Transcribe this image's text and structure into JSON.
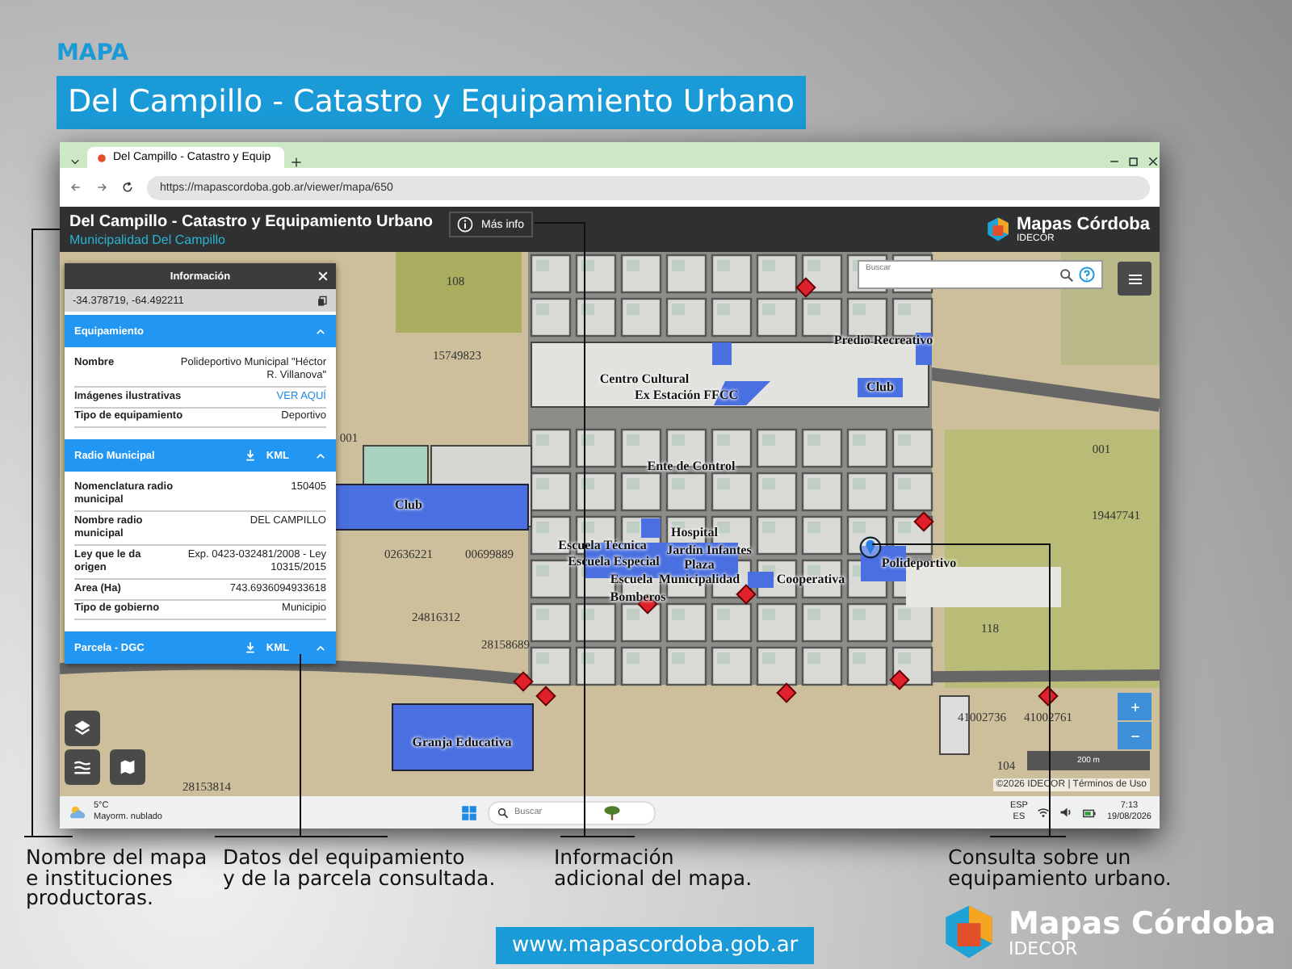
{
  "heading": "MAPA",
  "banner": "Del Campillo - Catastro y Equipamiento Urbano",
  "browser": {
    "tab": "Del Campillo - Catastro y Equip",
    "url": "https://mapascordoba.gob.ar/viewer/mapa/650"
  },
  "app_header": {
    "title": "Del Campillo - Catastro y Equipamiento Urbano",
    "subtitle": "Municipalidad Del Campillo",
    "info_button": "Más info",
    "logo_name": "Mapas Córdoba",
    "logo_sub": "IDECOR"
  },
  "info_panel": {
    "title": "Información",
    "coords": "-34.378719, -64.492211",
    "sections": [
      {
        "title": "Equipamiento",
        "expanded": true,
        "rows": [
          {
            "label": "Nombre",
            "value": "Polideportivo Municipal \"Héctor R. Villanova\"",
            "kind": "text"
          },
          {
            "label": "Imágenes ilustrativas",
            "value": "VER AQUÍ",
            "kind": "link"
          },
          {
            "label": "Tipo de equipamiento",
            "value": "Deportivo",
            "kind": "text"
          }
        ]
      },
      {
        "title": "Radio Municipal",
        "download": "KML",
        "expanded": true,
        "rows": [
          {
            "label": "Nomenclatura radio municipal",
            "value": "150405",
            "kind": "text"
          },
          {
            "label": "Nombre radio municipal",
            "value": "DEL CAMPILLO",
            "kind": "text"
          },
          {
            "label": "Ley que le da origen",
            "value": "Exp. 0423-032481/2008 - Ley 10315/2015",
            "kind": "text"
          },
          {
            "label": "Area (Ha)",
            "value": "743.6936094933618",
            "kind": "text"
          },
          {
            "label": "Tipo de gobierno",
            "value": "Municipio",
            "kind": "text"
          }
        ]
      },
      {
        "title": "Parcela - DGC",
        "download": "KML",
        "expanded": true
      }
    ]
  },
  "map": {
    "search_placeholder": "Buscar",
    "scale": "200 m",
    "attribution": "©2026 IDECOR | Términos de Uso",
    "labels": [
      {
        "text": "108",
        "kind": "parcel"
      },
      {
        "text": "15749823",
        "kind": "parcel"
      },
      {
        "text": "Predio Recreativo",
        "kind": "place"
      },
      {
        "text": "Centro Cultural",
        "kind": "place"
      },
      {
        "text": "Ex Estación FFCC",
        "kind": "place"
      },
      {
        "text": "Club",
        "kind": "place"
      },
      {
        "text": "001",
        "kind": "parcel"
      },
      {
        "text": "Ente de Control",
        "kind": "place"
      },
      {
        "text": "001",
        "kind": "parcel"
      },
      {
        "text": "Club",
        "kind": "place"
      },
      {
        "text": "19447741",
        "kind": "parcel"
      },
      {
        "text": "Hospital",
        "kind": "place"
      },
      {
        "text": "Escuela Técnica",
        "kind": "place"
      },
      {
        "text": "Jardín Infantes",
        "kind": "place"
      },
      {
        "text": "Escuela Especial",
        "kind": "place"
      },
      {
        "text": "Polideportivo",
        "kind": "place"
      },
      {
        "text": "02636221",
        "kind": "parcel"
      },
      {
        "text": "00699889",
        "kind": "parcel"
      },
      {
        "text": "Plaza",
        "kind": "place"
      },
      {
        "text": "Escuela",
        "kind": "place"
      },
      {
        "text": "Municipalidad",
        "kind": "place"
      },
      {
        "text": "Cooperativa",
        "kind": "place"
      },
      {
        "text": "Bomberos",
        "kind": "place"
      },
      {
        "text": "24816312",
        "kind": "parcel"
      },
      {
        "text": "118",
        "kind": "parcel"
      },
      {
        "text": "28158689",
        "kind": "parcel"
      },
      {
        "text": "41002736",
        "kind": "parcel"
      },
      {
        "text": "41002761",
        "kind": "parcel"
      },
      {
        "text": "Granja Educativa",
        "kind": "place"
      },
      {
        "text": "104",
        "kind": "parcel"
      },
      {
        "text": "28153814",
        "kind": "parcel"
      }
    ]
  },
  "taskbar": {
    "temperature": "5°C",
    "weather": "Mayorm. nublado",
    "search_placeholder": "Buscar",
    "lang": "ESP",
    "layout": "ES",
    "time": "7:13",
    "date": "19/08/2026"
  },
  "annotations": [
    "Nombre del mapa\ne instituciones\nproductoras.",
    "Datos del equipamiento\ny de la parcela consultada.",
    "Información\nadicional del mapa.",
    "Consulta sobre un\nequipamiento urbano."
  ],
  "footer": {
    "url": "www.mapascordoba.gob.ar",
    "logo_name": "Mapas Córdoba",
    "logo_sub": "IDECOR"
  }
}
